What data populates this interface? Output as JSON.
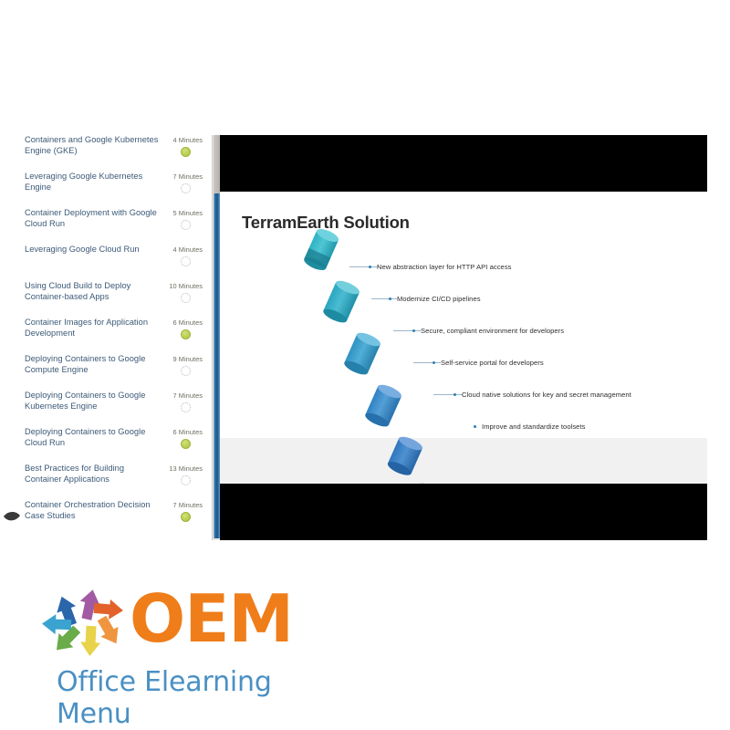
{
  "course_list": {
    "items": [
      {
        "title": "Containers and Google Kubernetes Engine (GKE)",
        "duration": "4 Minutes",
        "status": "completed",
        "current": false
      },
      {
        "title": "Leveraging Google Kubernetes Engine",
        "duration": "7 Minutes",
        "status": "not-started",
        "current": false
      },
      {
        "title": "Container Deployment with Google Cloud Run",
        "duration": "5 Minutes",
        "status": "not-started",
        "current": false
      },
      {
        "title": "Leveraging Google Cloud Run",
        "duration": "4 Minutes",
        "status": "not-started",
        "current": false
      },
      {
        "title": "Using Cloud Build to Deploy Container-based Apps",
        "duration": "10 Minutes",
        "status": "not-started",
        "current": false
      },
      {
        "title": "Container Images for Application Development",
        "duration": "6 Minutes",
        "status": "completed",
        "current": false
      },
      {
        "title": "Deploying Containers to Google Compute Engine",
        "duration": "9 Minutes",
        "status": "not-started",
        "current": false
      },
      {
        "title": "Deploying Containers to Google Kubernetes Engine",
        "duration": "7 Minutes",
        "status": "not-started",
        "current": false
      },
      {
        "title": "Deploying Containers to Google Cloud Run",
        "duration": "6 Minutes",
        "status": "completed",
        "current": false
      },
      {
        "title": "Best Practices for Building Container Applications",
        "duration": "13 Minutes",
        "status": "not-started",
        "current": false
      },
      {
        "title": "Container Orchestration Decision Case Studies",
        "duration": "7 Minutes",
        "status": "completed",
        "current": true
      }
    ]
  },
  "slide": {
    "title": "TerramEarth Solution",
    "bullets": [
      "New abstraction layer for HTTP API access",
      "Modernize CI/CD pipelines",
      "Secure, compliant environment for developers",
      "Self-service portal for developers",
      "Cloud native solutions for key and secret management",
      "Improve and standardize toolsets"
    ]
  },
  "logo": {
    "wordmark": "OEM",
    "tagline": "Office Elearning Menu",
    "wordmark_color": "#ef7d1a",
    "tagline_color": "#4a90c4"
  },
  "colors": {
    "status_completed": "#bcd054",
    "status_not_started": "#b9bcc2",
    "lesson_title": "#3c5a78",
    "progress_rail": "#1d578c"
  }
}
